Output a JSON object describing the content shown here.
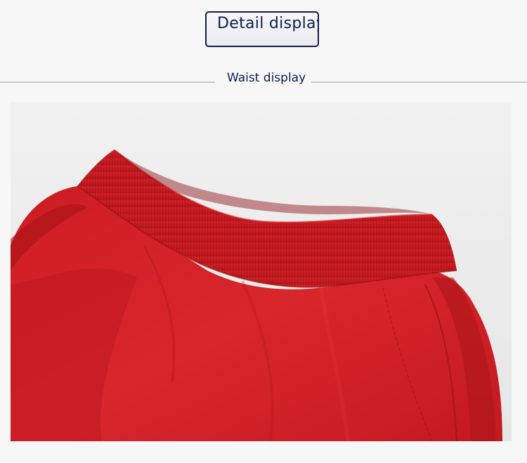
{
  "header": {
    "badge_label": "Detail display",
    "section_title": "Waist display"
  },
  "photo": {
    "subject": "red-pants-waistband-closeup",
    "colors": {
      "background": "#f7f7f7",
      "fabric": "#cc1f24",
      "accent_navy": "#0f1d4e"
    }
  }
}
